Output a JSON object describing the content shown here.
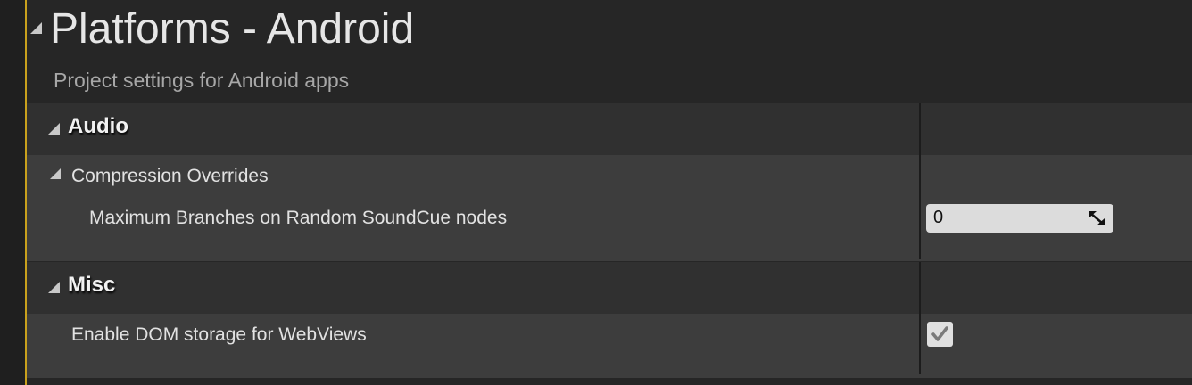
{
  "header": {
    "title": "Platforms - Android",
    "subtitle": "Project settings for Android apps"
  },
  "sections": [
    {
      "label": "Audio",
      "groups": [
        {
          "label": "Compression Overrides",
          "properties": [
            {
              "label": "Maximum Branches on Random SoundCue nodes",
              "value": "0"
            }
          ]
        }
      ]
    },
    {
      "label": "Misc",
      "properties": [
        {
          "label": "Enable DOM storage for WebViews",
          "checked": true
        }
      ]
    }
  ],
  "icons": {
    "collapse": "triangle-down-icon",
    "spin": "resize-arrows-icon",
    "check": "checkmark-icon"
  },
  "colors": {
    "accent": "#c9a11d",
    "background": "#262626",
    "section_header": "#303030",
    "property_row": "#3d3d3d"
  }
}
